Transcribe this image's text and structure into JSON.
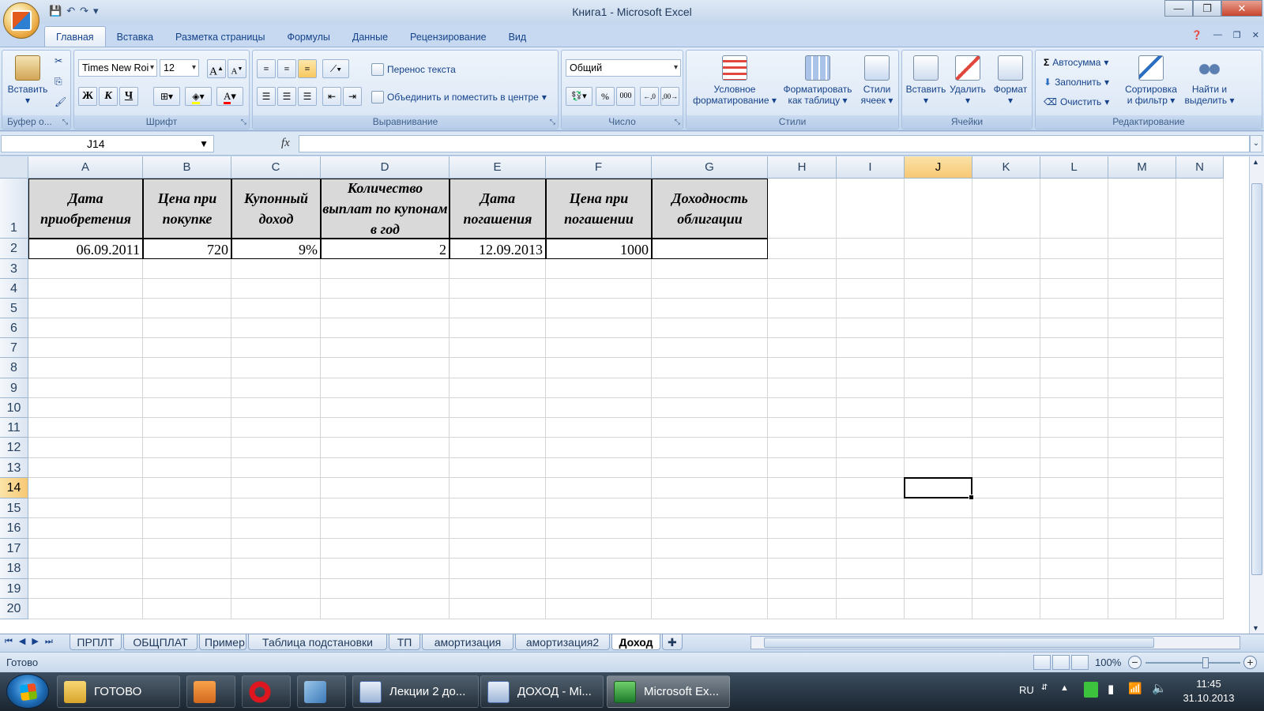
{
  "window": {
    "title": "Книга1 - Microsoft Excel",
    "minimize": "—",
    "maximize": "❐",
    "close": "✕"
  },
  "ribbon_tabs": [
    "Главная",
    "Вставка",
    "Разметка страницы",
    "Формулы",
    "Данные",
    "Рецензирование",
    "Вид"
  ],
  "ribbon": {
    "clipboard": {
      "label": "Буфер о...",
      "paste": "Вставить"
    },
    "font": {
      "label": "Шрифт",
      "name": "Times New Roi",
      "size": "12",
      "bold": "Ж",
      "italic": "К",
      "underline": "Ч"
    },
    "alignment": {
      "label": "Выравнивание",
      "wrap": "Перенос текста",
      "merge": "Объединить и поместить в центре"
    },
    "number": {
      "label": "Число",
      "format": "Общий",
      "percent": "%",
      "thousands": "000"
    },
    "styles": {
      "label": "Стили",
      "conditional": [
        "Условное",
        "форматирование"
      ],
      "table": [
        "Форматировать",
        "как таблицу"
      ],
      "cell": [
        "Стили",
        "ячеек"
      ]
    },
    "cells": {
      "label": "Ячейки",
      "insert": "Вставить",
      "delete": "Удалить",
      "format": "Формат"
    },
    "editing": {
      "label": "Редактирование",
      "autosum": "Автосумма",
      "fill": "Заполнить",
      "clear": "Очистить",
      "sort": [
        "Сортировка",
        "и фильтр"
      ],
      "find": [
        "Найти и",
        "выделить"
      ]
    }
  },
  "formula_bar": {
    "name_box": "J14",
    "fx": "fx",
    "value": ""
  },
  "columns": [
    "A",
    "B",
    "C",
    "D",
    "E",
    "F",
    "G",
    "H",
    "I",
    "J",
    "K",
    "L",
    "M",
    "N"
  ],
  "rows": [
    "1",
    "2",
    "3",
    "4",
    "5",
    "6",
    "7",
    "8",
    "9",
    "10",
    "11",
    "12",
    "13",
    "14",
    "15",
    "16",
    "17",
    "18",
    "19",
    "20"
  ],
  "table": {
    "headers": [
      "Дата приобретения",
      "Цена при покупке",
      "Купонный доход",
      "Количество выплат по купонам в год",
      "Дата погашения",
      "Цена при погашении",
      "Доходность облигации"
    ],
    "row2": [
      "06.09.2011",
      "720",
      "9%",
      "2",
      "12.09.2013",
      "1000",
      ""
    ]
  },
  "selected": {
    "column": "J",
    "row": "14"
  },
  "sheet_tabs": [
    "ПРПЛТ",
    "ОБЩПЛАТ",
    "Пример",
    "Таблица подстановки",
    "ТП",
    "амортизация",
    "амортизация2",
    "Доход"
  ],
  "active_sheet": "Доход",
  "status": {
    "text": "Готово",
    "zoom": "100%"
  },
  "taskbar": {
    "items": [
      "ГОТОВО",
      "Лекции 2 до...",
      "ДОХОД - Mi...",
      "Microsoft Ex..."
    ],
    "lang": "RU",
    "time": "11:45",
    "date": "31.10.2013"
  }
}
